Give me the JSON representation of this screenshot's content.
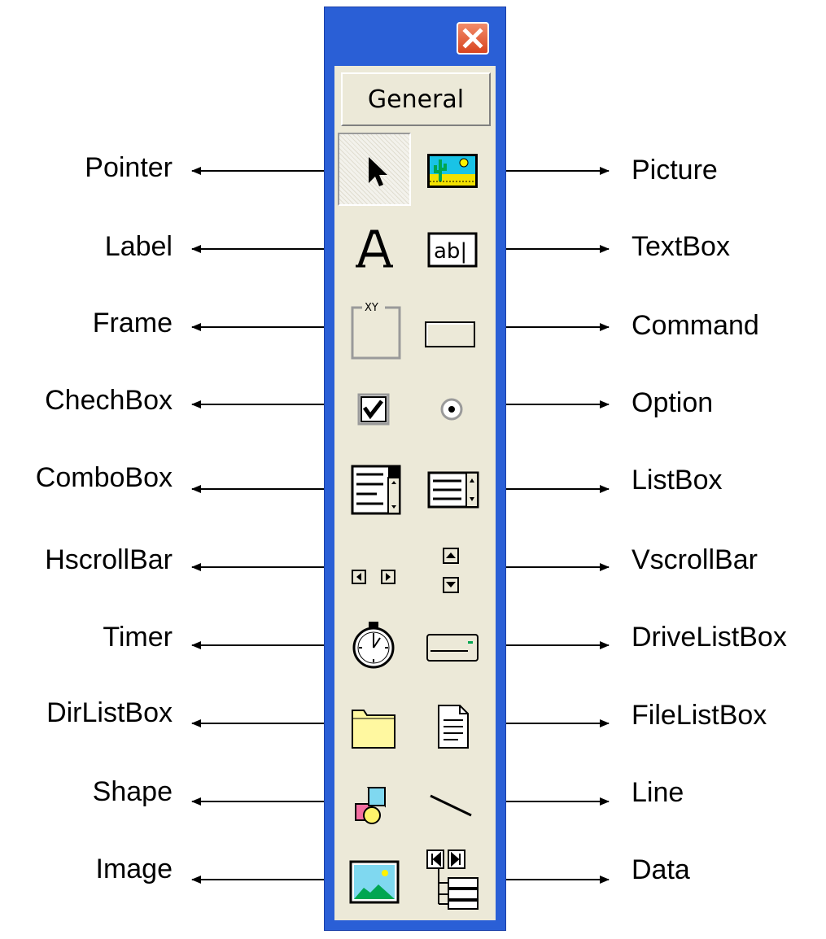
{
  "toolbox": {
    "tab_label": "General",
    "close_icon": "close-icon",
    "tools": [
      {
        "name": "Pointer",
        "icon": "pointer-arrow-icon",
        "selected": true
      },
      {
        "name": "Picture",
        "icon": "picture-box-icon"
      },
      {
        "name": "Label",
        "icon": "label-a-icon"
      },
      {
        "name": "TextBox",
        "icon": "textbox-ab-icon"
      },
      {
        "name": "Frame",
        "icon": "frame-xy-icon"
      },
      {
        "name": "Command",
        "icon": "command-button-icon"
      },
      {
        "name": "ChechBox",
        "icon": "checkbox-icon"
      },
      {
        "name": "Option",
        "icon": "option-button-icon"
      },
      {
        "name": "ComboBox",
        "icon": "combobox-icon"
      },
      {
        "name": "ListBox",
        "icon": "listbox-icon"
      },
      {
        "name": "HscrollBar",
        "icon": "hscrollbar-icon"
      },
      {
        "name": "VscrollBar",
        "icon": "vscrollbar-icon"
      },
      {
        "name": "Timer",
        "icon": "timer-stopwatch-icon"
      },
      {
        "name": "DriveListBox",
        "icon": "drive-listbox-icon"
      },
      {
        "name": "DirListBox",
        "icon": "folder-icon"
      },
      {
        "name": "FileListBox",
        "icon": "file-document-icon"
      },
      {
        "name": "Shape",
        "icon": "shapes-icon"
      },
      {
        "name": "Line",
        "icon": "line-icon"
      },
      {
        "name": "Image",
        "icon": "image-icon"
      },
      {
        "name": "Data",
        "icon": "data-control-icon"
      }
    ]
  },
  "labels": {
    "left": [
      "Pointer",
      "Label",
      "Frame",
      "ChechBox",
      "ComboBox",
      "HscrollBar",
      "Timer",
      "DirListBox",
      "Shape",
      "Image"
    ],
    "right": [
      "Picture",
      "TextBox",
      "Command",
      "Option",
      "ListBox",
      "VscrollBar",
      "DriveListBox",
      "FileListBox",
      "Line",
      "Data"
    ]
  },
  "colors": {
    "window_frame": "#2a5fd6",
    "toolbox_face": "#ece9d8",
    "close_button": "#d8441f",
    "arrow": "#000000"
  }
}
